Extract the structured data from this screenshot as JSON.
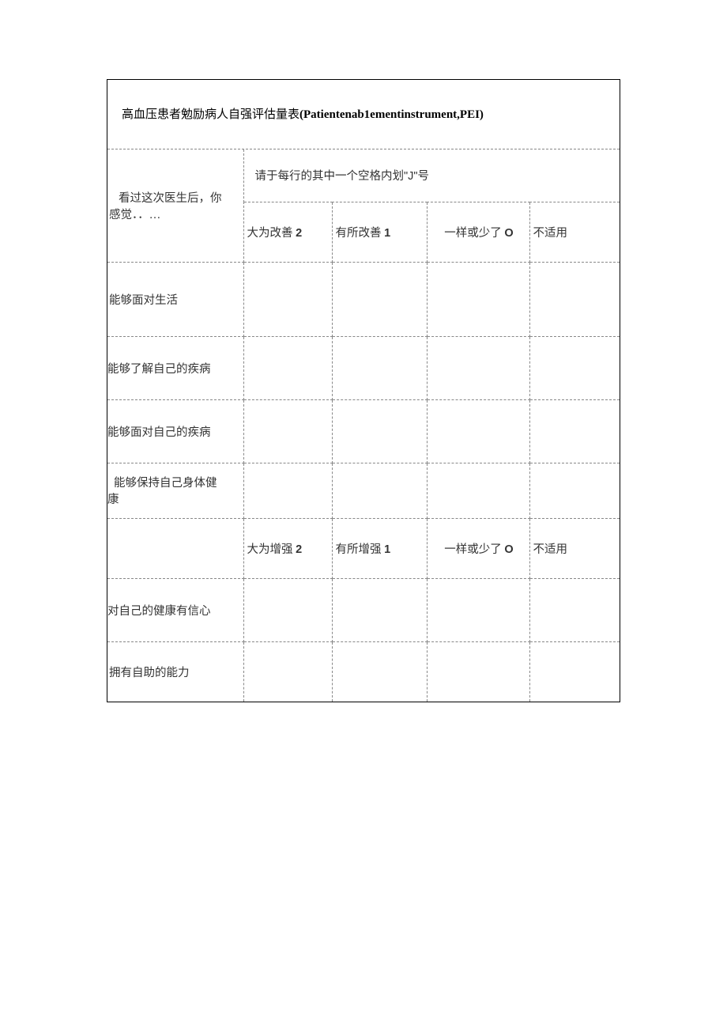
{
  "title_prefix": "高血压患者勉励病人自强评估量表",
  "title_paren": "(Patientenab1ementinstrument,PEI)",
  "left_header_line1": "看过这次医生后，你",
  "left_header_line2": "感觉．．…",
  "instruction_prefix": "请于每行的其中一个空格内划",
  "instruction_quote": "\"J\"",
  "instruction_suffix": "号",
  "scale1": {
    "col2_a": "大为改善 ",
    "col2_b": "2",
    "col3_a": "有所改善 ",
    "col3_b": "1",
    "col4_a": "一样或少了 ",
    "col4_b": "O",
    "col5": "不适用"
  },
  "items1": {
    "r1": "能够面对生活",
    "r2": "能够了解自己的疾病",
    "r3": "能够面对自己的疾病",
    "r4_line1": "能够保持自己身体健",
    "r4_line2": "康"
  },
  "scale2": {
    "col2_a": "大为增强 ",
    "col2_b": "2",
    "col3_a": "有所增强 ",
    "col3_b": "1",
    "col4_a": "一样或少了 ",
    "col4_b": "O",
    "col5": "不适用"
  },
  "items2": {
    "r1": "对自己的健康有信心",
    "r2": "拥有自助的能力"
  }
}
